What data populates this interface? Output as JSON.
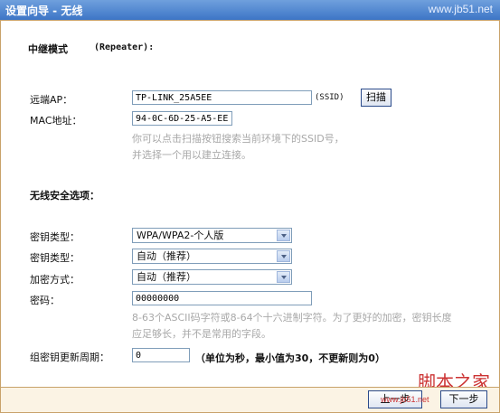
{
  "window": {
    "title": "设置向导 - 无线",
    "watermark": "www.jb51.net"
  },
  "section_mode": {
    "label": "中继模式",
    "value": "(Repeater):"
  },
  "remote_ap": {
    "label": "远端AP：",
    "value": "TP-LINK_25A5EE",
    "suffix": "(SSID)",
    "scan_button": "扫描"
  },
  "mac": {
    "label": "MAC地址：",
    "value": "94-0C-6D-25-A5-EE"
  },
  "hint1": {
    "line1": "你可以点击扫描按钮搜索当前环境下的SSID号，",
    "line2": "并选择一个用以建立连接。"
  },
  "security": {
    "section_label": "无线安全选项："
  },
  "key_type1": {
    "label": "密钥类型：",
    "value": "WPA/WPA2-个人版"
  },
  "key_type2": {
    "label": "密钥类型：",
    "value": "自动（推荐）"
  },
  "encryption": {
    "label": "加密方式：",
    "value": "自动（推荐）"
  },
  "password": {
    "label": "密码：",
    "value": "00000000"
  },
  "hint2": {
    "line1": "8-63个ASCII码字符或8-64个十六进制字符。为了更好的加密，密钥长度",
    "line2": "应足够长，并不是常用的字段。"
  },
  "group_key": {
    "label": "组密钥更新周期：",
    "value": "0",
    "note": "（单位为秒，最小值为30，不更新则为0）"
  },
  "footer": {
    "back_button": "上一步",
    "next_button": "下一步",
    "watermark": "脚本之家",
    "watermark_url": "www.jb51.net"
  }
}
